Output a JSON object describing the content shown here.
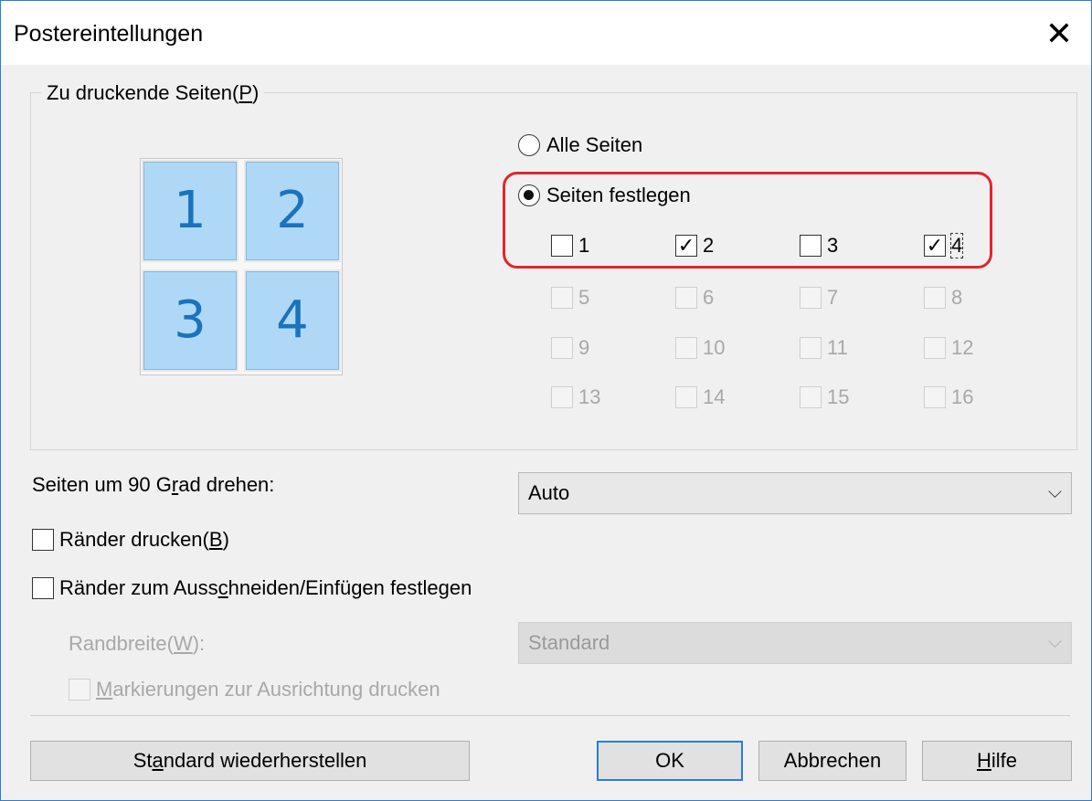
{
  "window": {
    "title": "Postereintellungen",
    "close_glyph": "✕"
  },
  "pages_group": {
    "title_prefix": "Zu druckende Seiten(",
    "title_mnemonic": "P",
    "title_suffix": ")",
    "preview_tiles": [
      "1",
      "2",
      "3",
      "4"
    ],
    "radio_all": {
      "label": "Alle Seiten",
      "selected": false
    },
    "radio_specify": {
      "label": "Seiten festlegen",
      "selected": true
    },
    "pages": [
      {
        "label": "1",
        "checked": false,
        "enabled": true
      },
      {
        "label": "2",
        "checked": true,
        "enabled": true
      },
      {
        "label": "3",
        "checked": false,
        "enabled": true
      },
      {
        "label": "4",
        "checked": true,
        "enabled": true
      },
      {
        "label": "5",
        "checked": false,
        "enabled": false
      },
      {
        "label": "6",
        "checked": false,
        "enabled": false
      },
      {
        "label": "7",
        "checked": false,
        "enabled": false
      },
      {
        "label": "8",
        "checked": false,
        "enabled": false
      },
      {
        "label": "9",
        "checked": false,
        "enabled": false
      },
      {
        "label": "10",
        "checked": false,
        "enabled": false
      },
      {
        "label": "11",
        "checked": false,
        "enabled": false
      },
      {
        "label": "12",
        "checked": false,
        "enabled": false
      },
      {
        "label": "13",
        "checked": false,
        "enabled": false
      },
      {
        "label": "14",
        "checked": false,
        "enabled": false
      },
      {
        "label": "15",
        "checked": false,
        "enabled": false
      },
      {
        "label": "16",
        "checked": false,
        "enabled": false
      }
    ],
    "highlight_color": "#e0262e"
  },
  "rotate": {
    "label_a": "Seiten um 90 G",
    "label_mnemonic": "r",
    "label_b": "ad drehen:",
    "value": "Auto"
  },
  "print_borders": {
    "label_a": "Ränder drucken(",
    "label_mnemonic": "B",
    "label_b": ")",
    "checked": false
  },
  "cut_margins": {
    "label_a": "Ränder zum Auss",
    "label_mnemonic": "c",
    "label_b": "hneiden/Einfügen festlegen",
    "checked": false
  },
  "margin_width": {
    "label_a": "Randbreite(",
    "label_mnemonic": "W",
    "label_b": "):",
    "value": "Standard"
  },
  "align_marks": {
    "label_mnemonic": "M",
    "label_b": "arkierungen zur Ausrichtung drucken",
    "checked": false
  },
  "buttons": {
    "restore_a": "St",
    "restore_mnemonic": "a",
    "restore_b": "ndard wiederherstellen",
    "ok": "OK",
    "cancel": "Abbrechen",
    "help_mnemonic": "H",
    "help_b": "ilfe"
  },
  "colors": {
    "accent": "#2b7fd1",
    "tile_fill": "#aed8f5",
    "tile_text": "#1a73bc"
  }
}
